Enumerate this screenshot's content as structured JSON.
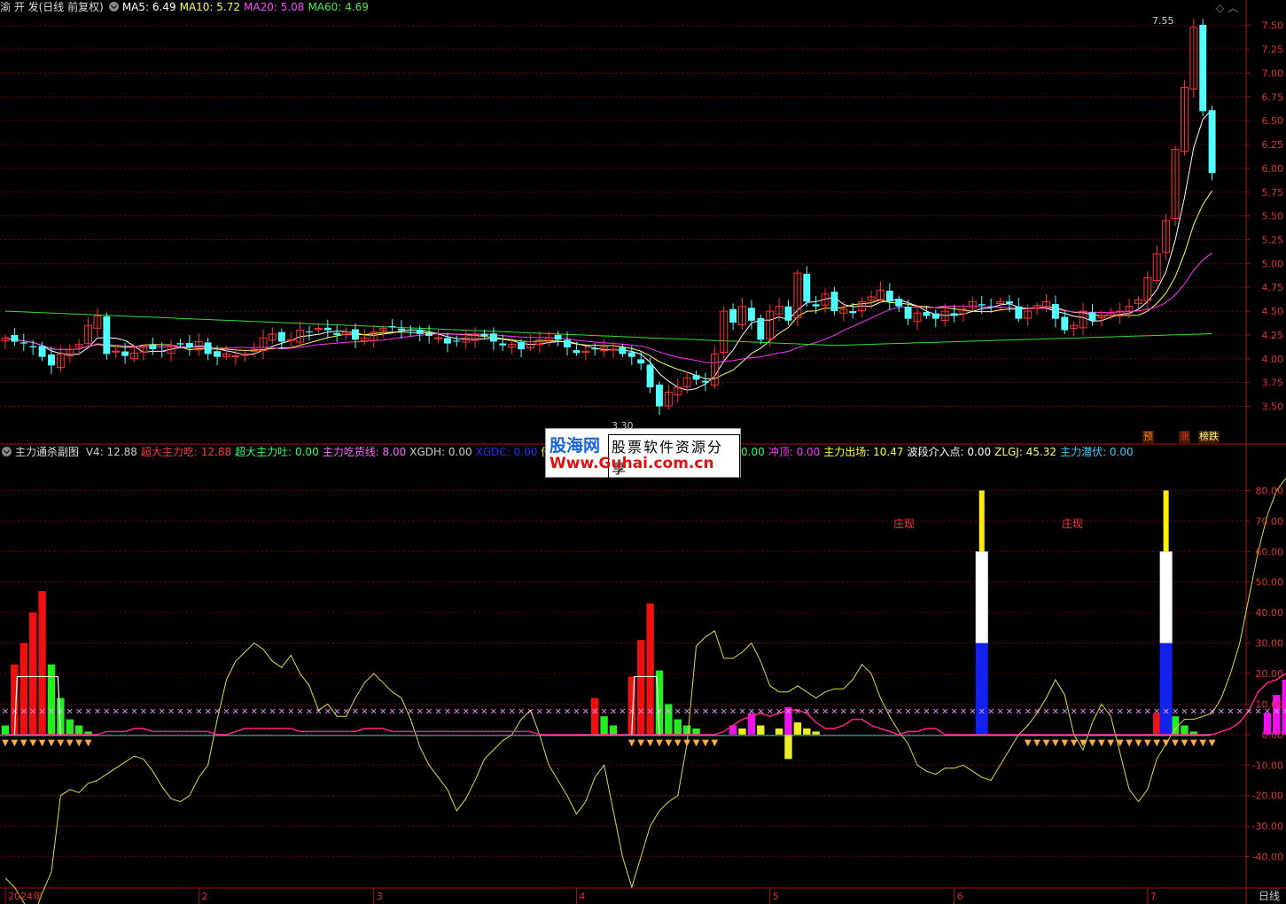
{
  "main_legend": {
    "title": "渝 开 发(日线 前复权)",
    "ma5": "MA5: 6.49",
    "ma10": "MA10: 5.72",
    "ma20": "MA20: 5.08",
    "ma60": "MA60: 4.69"
  },
  "sub_legend": {
    "title": "主力通杀副图",
    "items": [
      {
        "text": "V4: 12.88",
        "color": "#cccccc"
      },
      {
        "text": "超大主力吃: 12.88",
        "color": "#ff3b3b"
      },
      {
        "text": "超大主力吐: 0.00",
        "color": "#33ff66"
      },
      {
        "text": "主力吃货线: 8.00",
        "color": "#ff66ff"
      },
      {
        "text": "XGDH: 0.00",
        "color": "#cccccc"
      },
      {
        "text": "XGDC: 0.00",
        "color": "#2233ff"
      },
      {
        "text": "倍量吃",
        "color": "#ffff44"
      }
    ],
    "items2": [
      {
        "text": "0.00",
        "color": "#33ff66"
      },
      {
        "text": "冲顶: 0.00",
        "color": "#ff33ff"
      },
      {
        "text": "主力出场: 10.47",
        "color": "#ffff44"
      },
      {
        "text": "波段介入点: 0.00",
        "color": "#ffffff"
      },
      {
        "text": "ZLGJ: 45.32",
        "color": "#ffff66"
      },
      {
        "text": "主力潜伏: 0.00",
        "color": "#33ccff"
      }
    ]
  },
  "watermark": {
    "line1a": "股海网",
    "line1b": "股票软件资源分享",
    "line2": "Www.Guhai.com.cn"
  },
  "price_axis": [
    "7.50",
    "7.25",
    "7.00",
    "6.75",
    "6.50",
    "6.25",
    "6.00",
    "5.75",
    "5.50",
    "5.25",
    "5.00",
    "4.75",
    "4.50",
    "4.25",
    "4.00",
    "3.75",
    "3.50"
  ],
  "sub_axis": [
    "80.00",
    "70.00",
    "60.00",
    "50.00",
    "40.00",
    "30.00",
    "20.00",
    "10.00",
    "0.00",
    "-10.00",
    "-20.00",
    "-30.00",
    "-40.00"
  ],
  "month_axis": [
    "2024年",
    "2",
    "3",
    "4",
    "5",
    "6",
    "7"
  ],
  "period_label": "日线",
  "marks": {
    "high": "7.55",
    "low": "3.30"
  },
  "badges": [
    {
      "text": "预",
      "color": "#ff8800"
    },
    {
      "text": "涨",
      "color": "#ff3333"
    },
    {
      "text": "榜跌",
      "color": "#ffff66"
    }
  ],
  "zhuang": [
    "庄现",
    "庄现"
  ],
  "colors": {
    "up": "#ff3333",
    "down": "#54ffff",
    "ma5": "#ffffff",
    "ma10": "#ffff55",
    "ma20": "#ff33ff",
    "ma60": "#33dd33",
    "grid": "#7a0000"
  },
  "chart_data": [
    {
      "type": "candlestick",
      "title": "渝 开 发(日线 前复权)",
      "ylim": [
        3.3,
        7.6
      ],
      "x_months": [
        "2024年",
        "2",
        "3",
        "4",
        "5",
        "6",
        "7"
      ],
      "close": [
        4.22,
        4.18,
        4.16,
        4.12,
        4.02,
        3.93,
        4.05,
        4.1,
        4.15,
        4.35,
        4.45,
        4.05,
        4.08,
        4.03,
        4.06,
        4.12,
        4.1,
        4.08,
        4.14,
        4.15,
        4.12,
        4.18,
        4.05,
        4.02,
        4.05,
        4.03,
        4.05,
        4.1,
        4.22,
        4.26,
        4.18,
        4.2,
        4.3,
        4.28,
        4.32,
        4.3,
        4.25,
        4.28,
        4.2,
        4.22,
        4.28,
        4.32,
        4.34,
        4.3,
        4.28,
        4.26,
        4.24,
        4.22,
        4.16,
        4.18,
        4.22,
        4.25,
        4.24,
        4.18,
        4.14,
        4.15,
        4.1,
        4.18,
        4.2,
        4.22,
        4.2,
        4.12,
        4.06,
        4.08,
        4.1,
        4.12,
        4.1,
        4.05,
        4.02,
        3.95,
        3.7,
        3.5,
        3.65,
        3.7,
        3.8,
        3.78,
        3.75,
        4.05,
        4.5,
        4.38,
        4.55,
        4.4,
        4.2,
        4.5,
        4.55,
        4.4,
        4.9,
        4.6,
        4.55,
        4.68,
        4.5,
        4.52,
        4.48,
        4.6,
        4.65,
        4.72,
        4.6,
        4.55,
        4.42,
        4.48,
        4.45,
        4.42,
        4.5,
        4.45,
        4.52,
        4.6,
        4.56,
        4.55,
        4.6,
        4.58,
        4.42,
        4.5,
        4.56,
        4.6,
        4.42,
        4.3,
        4.35,
        4.5,
        4.4,
        4.45,
        4.48,
        4.5,
        4.55,
        4.62,
        4.85,
        5.1,
        5.45,
        6.2,
        6.85,
        7.48,
        6.6,
        5.95
      ],
      "ma": {
        "MA5": 6.49,
        "MA10": 5.72,
        "MA20": 5.08,
        "MA60": 4.69
      }
    },
    {
      "type": "bar",
      "title": "主力通杀副图",
      "ylim": [
        -50,
        90
      ],
      "bars": [
        {
          "i": 0,
          "v": 3,
          "c": "g"
        },
        {
          "i": 1,
          "v": 23,
          "c": "r"
        },
        {
          "i": 2,
          "v": 30,
          "c": "r"
        },
        {
          "i": 3,
          "v": 40,
          "c": "r"
        },
        {
          "i": 4,
          "v": 47,
          "c": "r"
        },
        {
          "i": 5,
          "v": 23,
          "c": "g"
        },
        {
          "i": 6,
          "v": 12,
          "c": "g"
        },
        {
          "i": 7,
          "v": 5,
          "c": "g"
        },
        {
          "i": 8,
          "v": 3,
          "c": "g"
        },
        {
          "i": 9,
          "v": 1,
          "c": "g"
        },
        {
          "i": 64,
          "v": 12,
          "c": "r"
        },
        {
          "i": 65,
          "v": 6,
          "c": "g"
        },
        {
          "i": 66,
          "v": 3,
          "c": "g"
        },
        {
          "i": 68,
          "v": 19,
          "c": "r"
        },
        {
          "i": 69,
          "v": 31,
          "c": "r"
        },
        {
          "i": 70,
          "v": 43,
          "c": "r"
        },
        {
          "i": 71,
          "v": 21,
          "c": "g"
        },
        {
          "i": 72,
          "v": 10,
          "c": "g"
        },
        {
          "i": 73,
          "v": 5,
          "c": "g"
        },
        {
          "i": 74,
          "v": 3,
          "c": "g"
        },
        {
          "i": 75,
          "v": 2,
          "c": "g"
        },
        {
          "i": 79,
          "v": 3,
          "c": "m"
        },
        {
          "i": 80,
          "v": 2,
          "c": "y"
        },
        {
          "i": 81,
          "v": 7,
          "c": "m"
        },
        {
          "i": 82,
          "v": 3,
          "c": "y"
        },
        {
          "i": 84,
          "v": 2,
          "c": "y"
        },
        {
          "i": 85,
          "v": 9,
          "c": "m"
        },
        {
          "i": 85,
          "v": -8,
          "c": "y"
        },
        {
          "i": 86,
          "v": 4,
          "c": "y"
        },
        {
          "i": 87,
          "v": 2,
          "c": "y"
        },
        {
          "i": 88,
          "v": 1,
          "c": "y"
        },
        {
          "i": 125,
          "v": 7,
          "c": "r"
        },
        {
          "i": 126,
          "v": 12,
          "c": "r"
        },
        {
          "i": 127,
          "v": 6,
          "c": "g"
        },
        {
          "i": 128,
          "v": 3,
          "c": "g"
        },
        {
          "i": 129,
          "v": 1,
          "c": "g"
        },
        {
          "i": 137,
          "v": 7,
          "c": "m"
        },
        {
          "i": 138,
          "v": 13,
          "c": "m"
        },
        {
          "i": 139,
          "v": 18,
          "c": "m"
        },
        {
          "i": 140,
          "v": 23,
          "c": "m"
        },
        {
          "i": 141,
          "v": 31,
          "c": "m"
        },
        {
          "i": 142,
          "v": 42,
          "c": "m"
        },
        {
          "i": 143,
          "v": 20,
          "c": "y"
        },
        {
          "i": 144,
          "v": 10,
          "c": "y"
        }
      ],
      "zhuang_at": [
        106,
        126
      ],
      "main_line_level": 8,
      "yellow_line": [
        -47,
        -50,
        -55,
        -60,
        -52,
        -45,
        -20,
        -18,
        -19,
        -16,
        -15,
        -13,
        -11,
        -9,
        -7,
        -8,
        -12,
        -17,
        -21,
        -22,
        -20,
        -14,
        -10,
        5,
        18,
        24,
        27,
        30,
        28,
        24,
        22,
        26,
        20,
        16,
        8,
        10,
        6,
        6,
        12,
        17,
        20,
        17,
        14,
        12,
        5,
        -4,
        -10,
        -14,
        -18,
        -25,
        -21,
        -15,
        -8,
        -5,
        -2,
        0,
        5,
        8,
        0,
        -10,
        -15,
        -20,
        -26,
        -22,
        -14,
        -10,
        -25,
        -40,
        -50,
        -40,
        -30,
        -25,
        -22,
        -20,
        -3,
        29,
        32,
        34,
        25,
        25,
        27,
        30,
        24,
        16,
        14,
        14,
        16,
        14,
        12,
        14,
        15,
        15,
        18,
        23,
        20,
        12,
        6,
        1,
        -3,
        -10,
        -12,
        -13,
        -11,
        -11,
        -10,
        -12,
        -14,
        -15,
        -10,
        -5,
        0,
        3,
        7,
        12,
        18,
        13,
        0,
        -5,
        4,
        10,
        6,
        -6,
        -18,
        -22,
        -18,
        -8,
        -3,
        2,
        5,
        5,
        6,
        7,
        12,
        20,
        30,
        45,
        60,
        72,
        80,
        84,
        86,
        65,
        47
      ],
      "pink_line": [
        0,
        0,
        0,
        0,
        0,
        0,
        0,
        0,
        0,
        0,
        0,
        1,
        1,
        1,
        2,
        2,
        1,
        1,
        1,
        1,
        1,
        1,
        1,
        0,
        0,
        1,
        2,
        2,
        2,
        2,
        2,
        2,
        1,
        1,
        1,
        1,
        1,
        1,
        1,
        2,
        2,
        2,
        1,
        1,
        1,
        1,
        1,
        1,
        1,
        1,
        1,
        1,
        1,
        1,
        1,
        1,
        1,
        1,
        0,
        0,
        0,
        0,
        0,
        0,
        0,
        0,
        0,
        0,
        0,
        0,
        0,
        0,
        0,
        0,
        0,
        0,
        0,
        0,
        1,
        3,
        5,
        6,
        7,
        6,
        7,
        8,
        8,
        7,
        4,
        2,
        2,
        3,
        5,
        5,
        3,
        2,
        1,
        0,
        1,
        1,
        2,
        2,
        0,
        0,
        0,
        0,
        0,
        0,
        0,
        0,
        0,
        0,
        0,
        0,
        0,
        0,
        0,
        0,
        0,
        0,
        0,
        0,
        0,
        0,
        0,
        0,
        0,
        0,
        0,
        0,
        0,
        0,
        1,
        2,
        4,
        8,
        14,
        17,
        18,
        20,
        20,
        18,
        14,
        12
      ]
    }
  ]
}
